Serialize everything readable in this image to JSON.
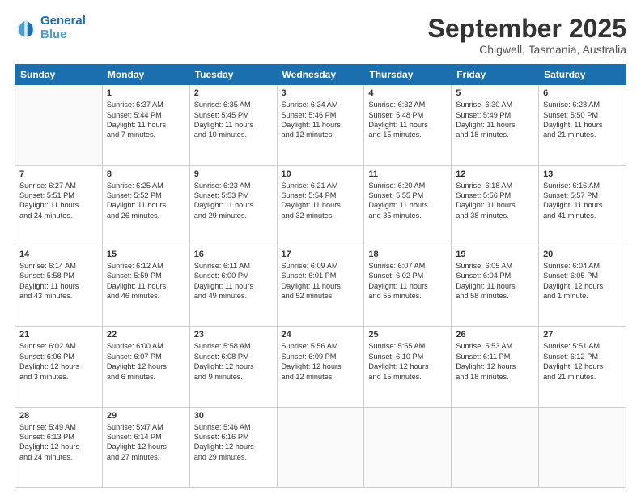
{
  "logo": {
    "line1": "General",
    "line2": "Blue"
  },
  "header": {
    "month": "September 2025",
    "location": "Chigwell, Tasmania, Australia"
  },
  "days": [
    "Sunday",
    "Monday",
    "Tuesday",
    "Wednesday",
    "Thursday",
    "Friday",
    "Saturday"
  ],
  "weeks": [
    [
      {
        "day": "",
        "content": ""
      },
      {
        "day": "1",
        "content": "Sunrise: 6:37 AM\nSunset: 5:44 PM\nDaylight: 11 hours\nand 7 minutes."
      },
      {
        "day": "2",
        "content": "Sunrise: 6:35 AM\nSunset: 5:45 PM\nDaylight: 11 hours\nand 10 minutes."
      },
      {
        "day": "3",
        "content": "Sunrise: 6:34 AM\nSunset: 5:46 PM\nDaylight: 11 hours\nand 12 minutes."
      },
      {
        "day": "4",
        "content": "Sunrise: 6:32 AM\nSunset: 5:48 PM\nDaylight: 11 hours\nand 15 minutes."
      },
      {
        "day": "5",
        "content": "Sunrise: 6:30 AM\nSunset: 5:49 PM\nDaylight: 11 hours\nand 18 minutes."
      },
      {
        "day": "6",
        "content": "Sunrise: 6:28 AM\nSunset: 5:50 PM\nDaylight: 11 hours\nand 21 minutes."
      }
    ],
    [
      {
        "day": "7",
        "content": "Sunrise: 6:27 AM\nSunset: 5:51 PM\nDaylight: 11 hours\nand 24 minutes."
      },
      {
        "day": "8",
        "content": "Sunrise: 6:25 AM\nSunset: 5:52 PM\nDaylight: 11 hours\nand 26 minutes."
      },
      {
        "day": "9",
        "content": "Sunrise: 6:23 AM\nSunset: 5:53 PM\nDaylight: 11 hours\nand 29 minutes."
      },
      {
        "day": "10",
        "content": "Sunrise: 6:21 AM\nSunset: 5:54 PM\nDaylight: 11 hours\nand 32 minutes."
      },
      {
        "day": "11",
        "content": "Sunrise: 6:20 AM\nSunset: 5:55 PM\nDaylight: 11 hours\nand 35 minutes."
      },
      {
        "day": "12",
        "content": "Sunrise: 6:18 AM\nSunset: 5:56 PM\nDaylight: 11 hours\nand 38 minutes."
      },
      {
        "day": "13",
        "content": "Sunrise: 6:16 AM\nSunset: 5:57 PM\nDaylight: 11 hours\nand 41 minutes."
      }
    ],
    [
      {
        "day": "14",
        "content": "Sunrise: 6:14 AM\nSunset: 5:58 PM\nDaylight: 11 hours\nand 43 minutes."
      },
      {
        "day": "15",
        "content": "Sunrise: 6:12 AM\nSunset: 5:59 PM\nDaylight: 11 hours\nand 46 minutes."
      },
      {
        "day": "16",
        "content": "Sunrise: 6:11 AM\nSunset: 6:00 PM\nDaylight: 11 hours\nand 49 minutes."
      },
      {
        "day": "17",
        "content": "Sunrise: 6:09 AM\nSunset: 6:01 PM\nDaylight: 11 hours\nand 52 minutes."
      },
      {
        "day": "18",
        "content": "Sunrise: 6:07 AM\nSunset: 6:02 PM\nDaylight: 11 hours\nand 55 minutes."
      },
      {
        "day": "19",
        "content": "Sunrise: 6:05 AM\nSunset: 6:04 PM\nDaylight: 11 hours\nand 58 minutes."
      },
      {
        "day": "20",
        "content": "Sunrise: 6:04 AM\nSunset: 6:05 PM\nDaylight: 12 hours\nand 1 minute."
      }
    ],
    [
      {
        "day": "21",
        "content": "Sunrise: 6:02 AM\nSunset: 6:06 PM\nDaylight: 12 hours\nand 3 minutes."
      },
      {
        "day": "22",
        "content": "Sunrise: 6:00 AM\nSunset: 6:07 PM\nDaylight: 12 hours\nand 6 minutes."
      },
      {
        "day": "23",
        "content": "Sunrise: 5:58 AM\nSunset: 6:08 PM\nDaylight: 12 hours\nand 9 minutes."
      },
      {
        "day": "24",
        "content": "Sunrise: 5:56 AM\nSunset: 6:09 PM\nDaylight: 12 hours\nand 12 minutes."
      },
      {
        "day": "25",
        "content": "Sunrise: 5:55 AM\nSunset: 6:10 PM\nDaylight: 12 hours\nand 15 minutes."
      },
      {
        "day": "26",
        "content": "Sunrise: 5:53 AM\nSunset: 6:11 PM\nDaylight: 12 hours\nand 18 minutes."
      },
      {
        "day": "27",
        "content": "Sunrise: 5:51 AM\nSunset: 6:12 PM\nDaylight: 12 hours\nand 21 minutes."
      }
    ],
    [
      {
        "day": "28",
        "content": "Sunrise: 5:49 AM\nSunset: 6:13 PM\nDaylight: 12 hours\nand 24 minutes."
      },
      {
        "day": "29",
        "content": "Sunrise: 5:47 AM\nSunset: 6:14 PM\nDaylight: 12 hours\nand 27 minutes."
      },
      {
        "day": "30",
        "content": "Sunrise: 5:46 AM\nSunset: 6:16 PM\nDaylight: 12 hours\nand 29 minutes."
      },
      {
        "day": "",
        "content": ""
      },
      {
        "day": "",
        "content": ""
      },
      {
        "day": "",
        "content": ""
      },
      {
        "day": "",
        "content": ""
      }
    ]
  ]
}
